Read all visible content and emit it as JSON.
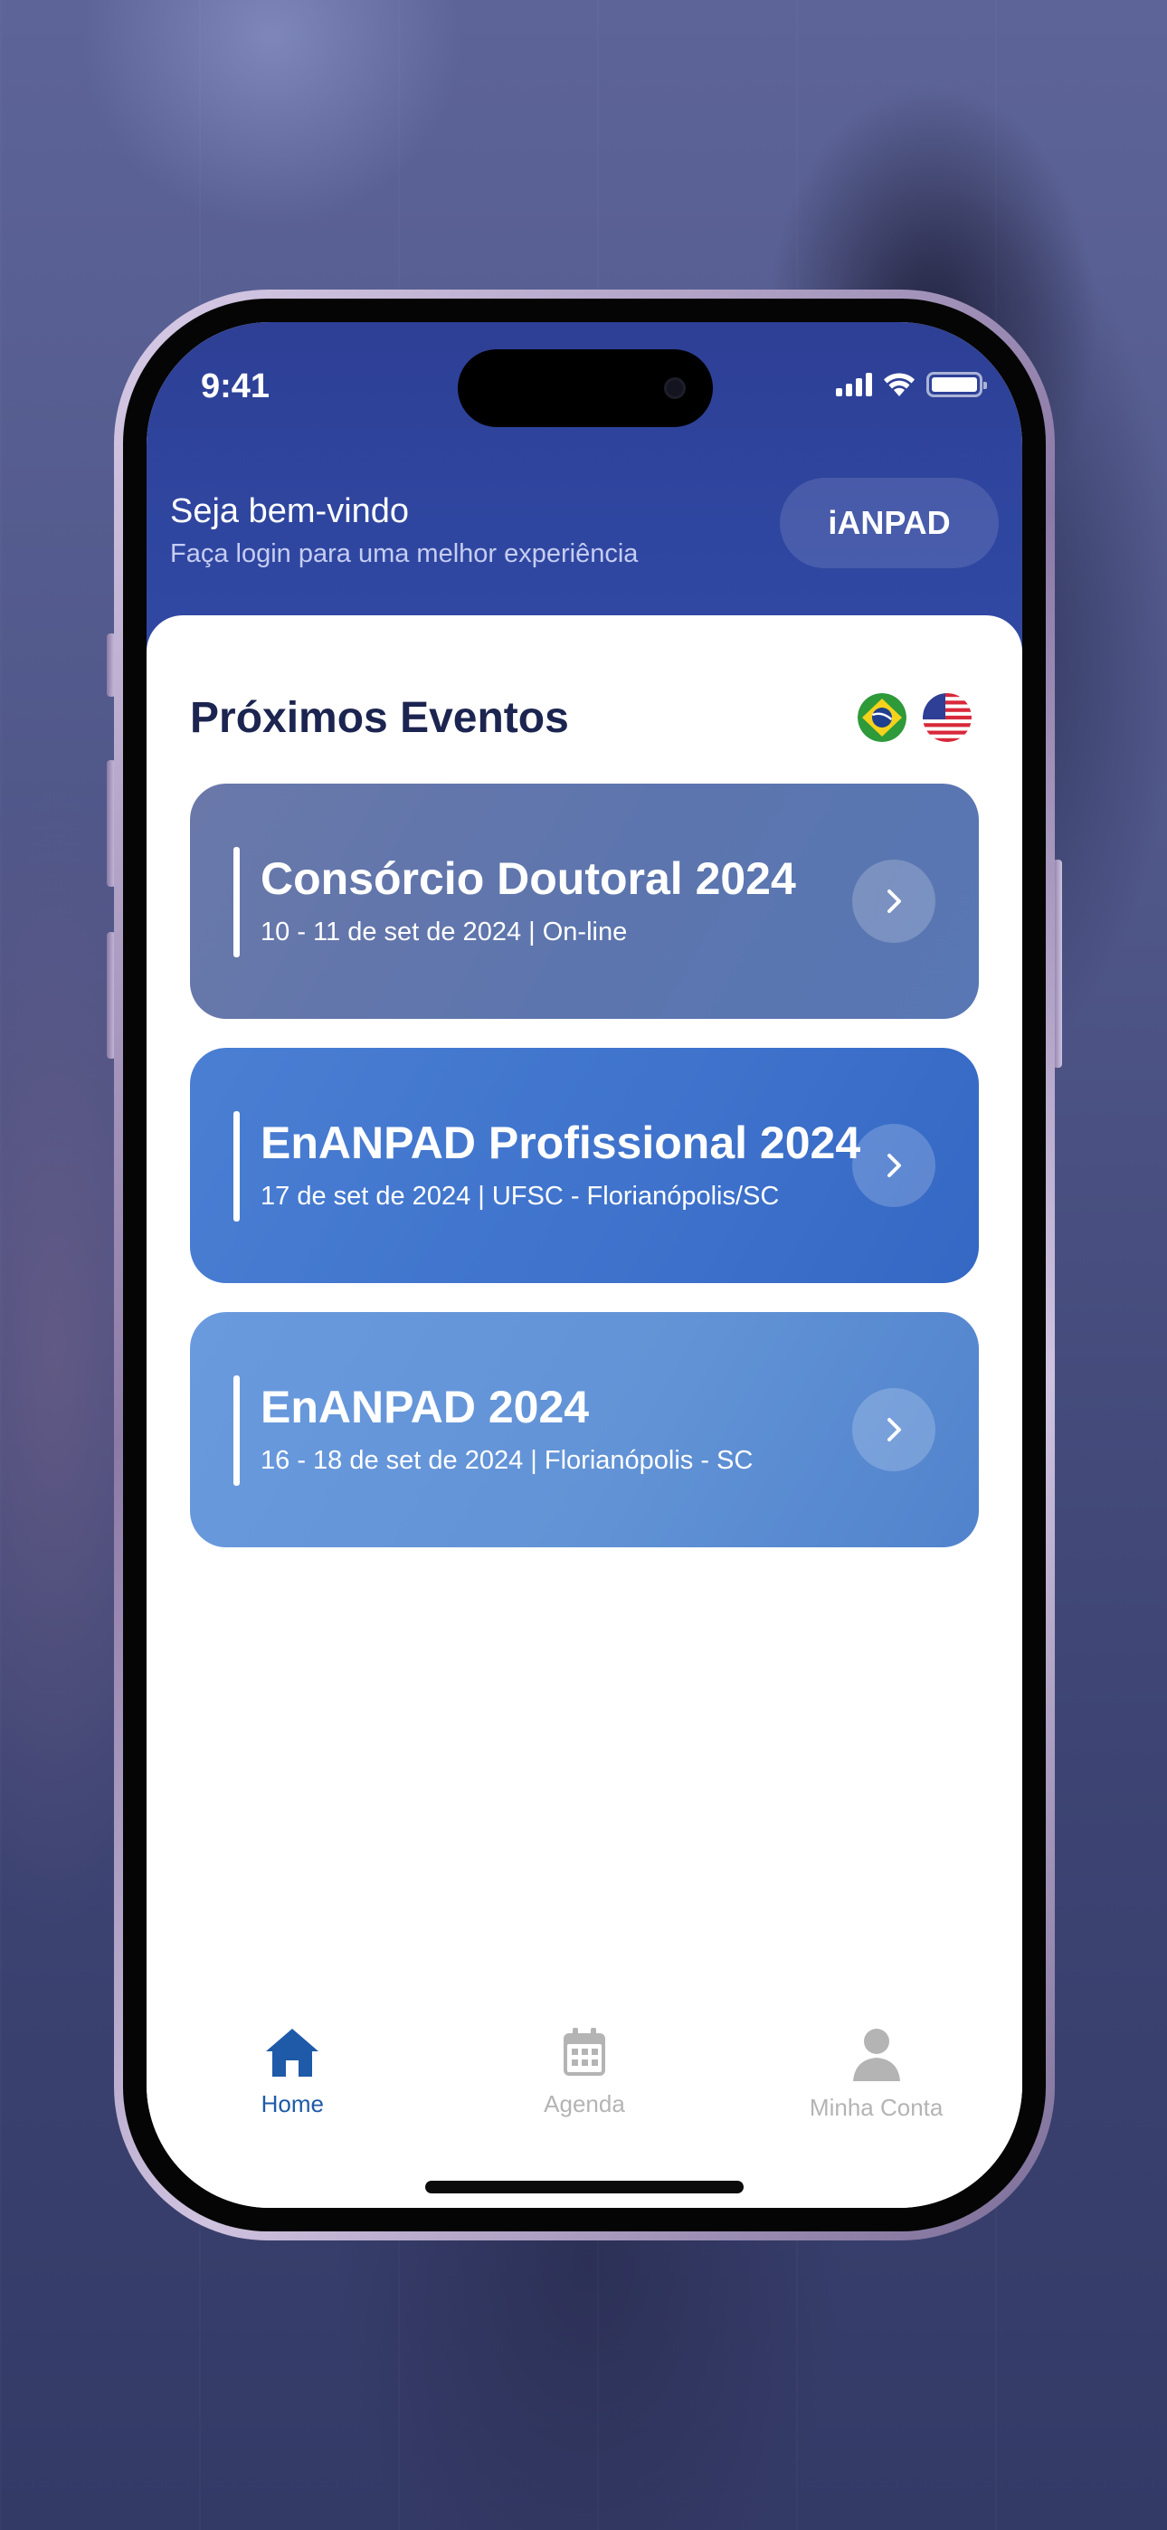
{
  "status_bar": {
    "time": "9:41"
  },
  "header": {
    "title": "Seja bem-vindo",
    "subtitle": "Faça login para uma melhor experiência",
    "ianpad_button": "iANPAD"
  },
  "section": {
    "title": "Próximos Eventos",
    "languages": [
      "Português (Brasil)",
      "English (US)"
    ]
  },
  "events": [
    {
      "title": "Consórcio Doutoral 2024",
      "meta": "10 - 11 de set de 2024 | On-line",
      "color": "#5f77ad"
    },
    {
      "title": "EnANPAD Profissional 2024",
      "meta": "17 de set de 2024 | UFSC - Florianópolis/SC",
      "color": "#3f73cc"
    },
    {
      "title": "EnANPAD 2024",
      "meta": "16 - 18 de set de 2024 | Florianópolis - SC",
      "color": "#6293d6"
    }
  ],
  "tabs": [
    {
      "label": "Home",
      "icon": "home-icon",
      "active": true
    },
    {
      "label": "Agenda",
      "icon": "calendar-icon",
      "active": false
    },
    {
      "label": "Minha Conta",
      "icon": "user-icon",
      "active": false
    }
  ],
  "colors": {
    "header": "#2f46a0",
    "active_tab": "#1e5aa8",
    "inactive_tab": "#b4b4b4",
    "section_title": "#1c2450"
  }
}
